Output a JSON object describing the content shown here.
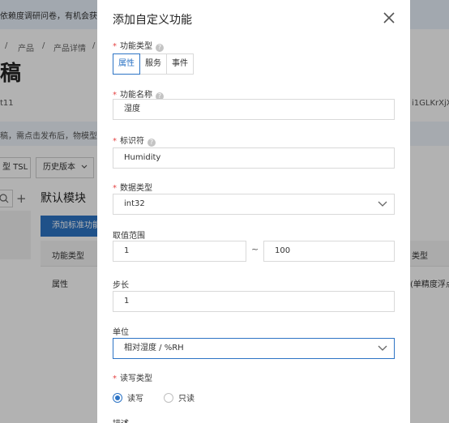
{
  "background": {
    "notice": "依赖度调研问卷，有机会获得",
    "breadcrumb": [
      "/",
      "产品",
      "/",
      "产品详情",
      "/"
    ],
    "title": "稿",
    "product_suffix": "t11",
    "product_key_fragment": "i1GLKrXjXsU",
    "tip": "稿，需点击发布后，物模型才",
    "tsl_button": "型 TSL",
    "history_button": "历史版本",
    "module_title": "默认模块",
    "add_standard_button": "添加标准功能",
    "table": {
      "col_type": "功能类型",
      "col_data_type_frag": "类型",
      "row_type": "属性",
      "row_data_type_frag": "(单精度浮点"
    }
  },
  "modal": {
    "title": "添加自定义功能",
    "close_icon": "close-icon",
    "function_type": {
      "label": "功能类型",
      "options": [
        "属性",
        "服务",
        "事件"
      ],
      "selected": "属性"
    },
    "function_name": {
      "label": "功能名称",
      "value": "湿度"
    },
    "identifier": {
      "label": "标识符",
      "value": "Humidity"
    },
    "data_type": {
      "label": "数据类型",
      "value": "int32"
    },
    "value_range": {
      "label": "取值范围",
      "min": "1",
      "separator": "~",
      "max": "100"
    },
    "step": {
      "label": "步长",
      "value": "1"
    },
    "unit": {
      "label": "单位",
      "value": "相对湿度 / %RH"
    },
    "rw_type": {
      "label": "读写类型",
      "options": [
        "读写",
        "只读"
      ],
      "selected": "读写"
    },
    "description": {
      "label": "描述"
    }
  },
  "colors": {
    "accent": "#2d74c5",
    "required": "#e54545",
    "overlay": "rgba(0,0,0,0.30)"
  }
}
